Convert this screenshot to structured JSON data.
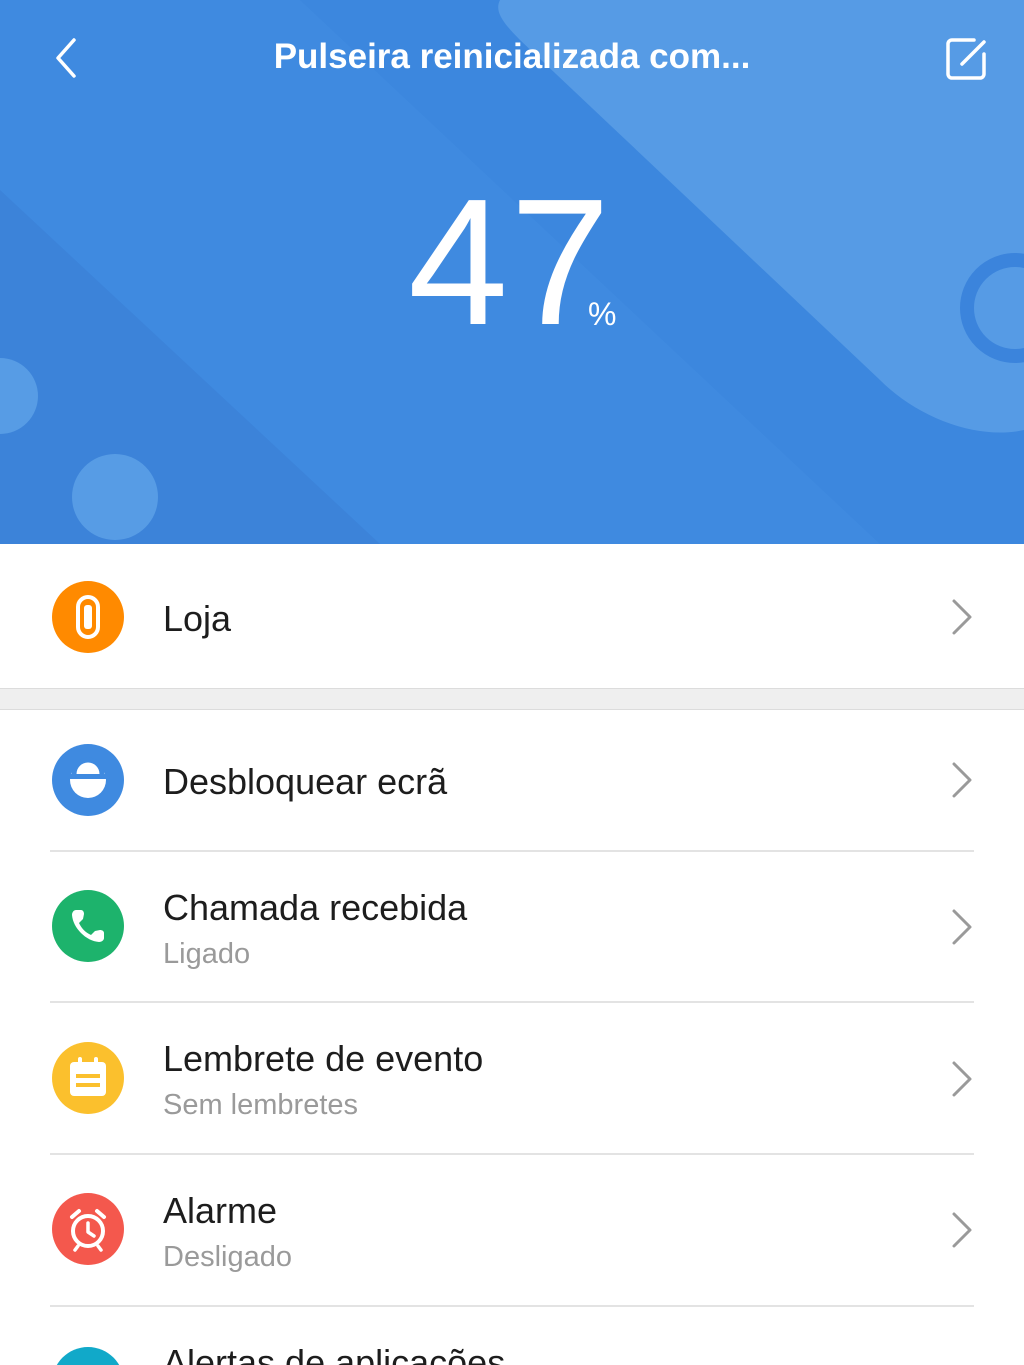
{
  "header": {
    "title": "Pulseira reinicializada com...",
    "battery_value": "47",
    "battery_unit": "%",
    "battery_level_percent": 47,
    "background_color": "#3f8ae0",
    "back_icon": "chevron-left-icon",
    "edit_icon": "edit-icon"
  },
  "menu": {
    "items": [
      {
        "label": "Loja",
        "icon": "band-icon",
        "icon_color": "#ff8a00"
      },
      {
        "label": "Desbloquear ecrã",
        "icon": "unlock-icon",
        "icon_color": "#3f8ae0"
      },
      {
        "label": "Chamada recebida",
        "subtitle": "Ligado",
        "icon": "phone-icon",
        "icon_color": "#1db36c"
      },
      {
        "label": "Lembrete de evento",
        "subtitle": "Sem lembretes",
        "icon": "calendar-note-icon",
        "icon_color": "#fbc02d"
      },
      {
        "label": "Alarme",
        "subtitle": "Desligado",
        "icon": "alarm-clock-icon",
        "icon_color": "#f4584d"
      },
      {
        "label": "Alertas de aplicações",
        "icon": "app-alert-icon",
        "icon_color": "#11a9c9"
      }
    ]
  }
}
